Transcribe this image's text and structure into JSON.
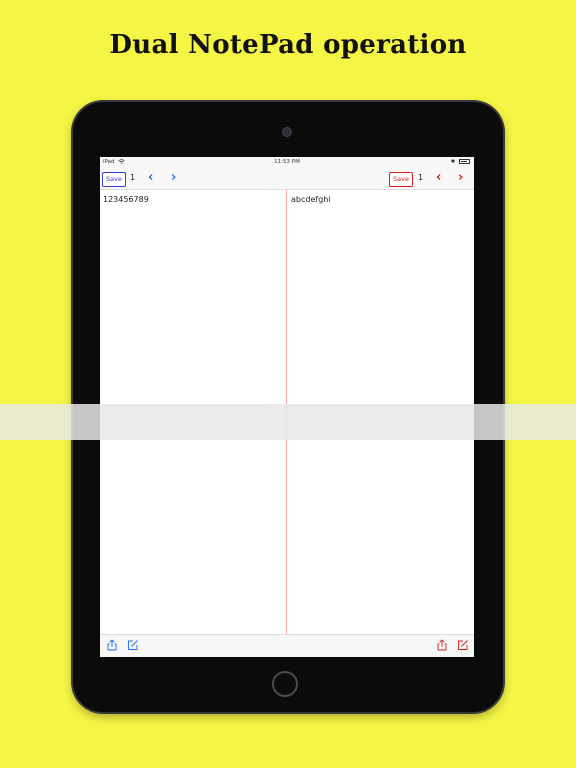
{
  "headline": "Dual NotePad operation",
  "status_bar": {
    "device": "iPad",
    "time": "11:53 PM",
    "bluetooth": "✱"
  },
  "left_pad": {
    "save_label": "Save",
    "page_number": "1",
    "prev_glyph": "‹",
    "next_glyph": "›",
    "content": "123456789",
    "accent_color": "#1a6cf0"
  },
  "right_pad": {
    "save_label": "Save",
    "page_number": "1",
    "prev_glyph": "‹",
    "next_glyph": "›",
    "content": "abcdefghi",
    "accent_color": "#d62020"
  },
  "icons": [
    "wifi-icon",
    "bluetooth-icon",
    "battery-icon",
    "share-icon",
    "compose-icon",
    "chevron-left-icon",
    "chevron-right-icon"
  ],
  "colors": {
    "background": "#f5f545",
    "divider": "#f4aaaa",
    "device_bezel": "#0b0b0b"
  }
}
